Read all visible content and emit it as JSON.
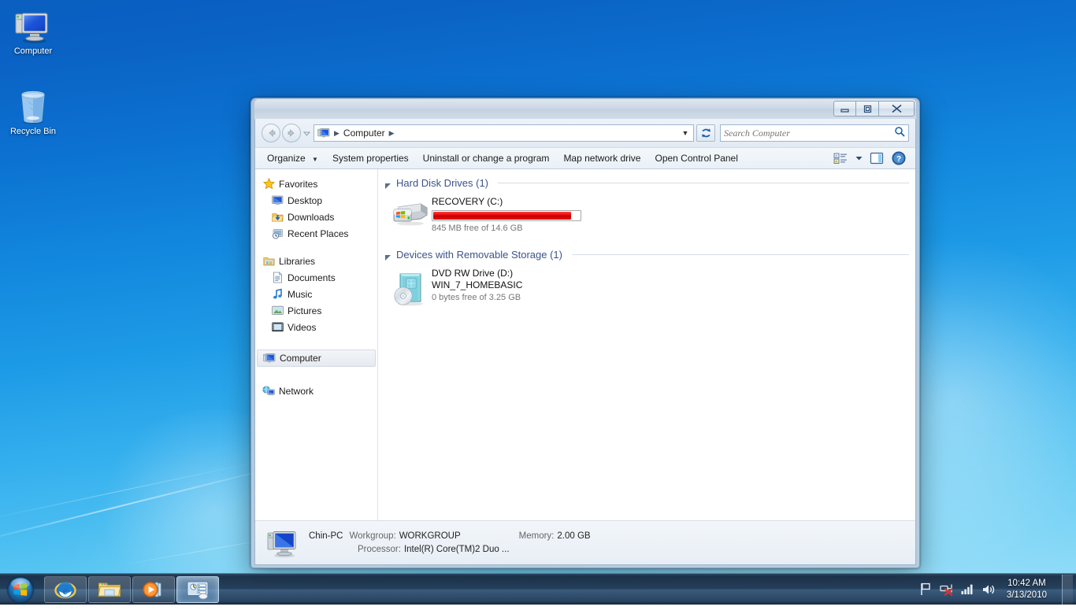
{
  "desktop": {
    "icons": [
      {
        "label": "Computer",
        "icon": "computer-icon"
      },
      {
        "label": "Recycle Bin",
        "icon": "recycle-bin-icon"
      }
    ]
  },
  "window": {
    "title": "",
    "controls": {
      "minimize": "Minimize",
      "maximize": "Maximize",
      "close": "Close"
    },
    "address": {
      "back": "Back",
      "forward": "Forward",
      "history_label": "Recent pages",
      "breadcrumb": [
        "Computer"
      ],
      "refresh": "Refresh"
    },
    "search": {
      "value": "",
      "placeholder": "Search Computer"
    },
    "toolbar": {
      "organize": "Organize",
      "items": [
        "System properties",
        "Uninstall or change a program",
        "Map network drive",
        "Open Control Panel"
      ],
      "views_label": "Change your view",
      "preview_label": "Show the preview pane",
      "help_label": "Get help"
    },
    "navpane": {
      "groups": [
        {
          "header": {
            "label": "Favorites",
            "icon": "star-icon"
          },
          "items": [
            {
              "label": "Desktop",
              "icon": "desktop-icon"
            },
            {
              "label": "Downloads",
              "icon": "downloads-icon"
            },
            {
              "label": "Recent Places",
              "icon": "recent-places-icon"
            }
          ]
        },
        {
          "header": {
            "label": "Libraries",
            "icon": "libraries-icon"
          },
          "items": [
            {
              "label": "Documents",
              "icon": "documents-icon"
            },
            {
              "label": "Music",
              "icon": "music-icon"
            },
            {
              "label": "Pictures",
              "icon": "pictures-icon"
            },
            {
              "label": "Videos",
              "icon": "videos-icon"
            }
          ]
        }
      ],
      "computer": {
        "label": "Computer",
        "icon": "computer-icon",
        "selected": true
      },
      "network": {
        "label": "Network",
        "icon": "network-icon"
      }
    },
    "content": {
      "groups": [
        {
          "title": "Hard Disk Drives (1)",
          "drives": [
            {
              "name": "RECOVERY (C:)",
              "subtitle": "",
              "free_text": "845 MB free of 14.6 GB",
              "has_bar": true,
              "used_percent": 94,
              "bar_color": "#e00000",
              "icon": "hard-disk-icon"
            }
          ]
        },
        {
          "title": "Devices with Removable Storage (1)",
          "drives": [
            {
              "name": "DVD RW Drive (D:)",
              "subtitle": "WIN_7_HOMEBASIC",
              "free_text": "0 bytes free of 3.25 GB",
              "has_bar": false,
              "used_percent": 100,
              "bar_color": "#e00000",
              "icon": "dvd-drive-icon"
            }
          ]
        }
      ]
    },
    "statusbar": {
      "computer_name": "Chin-PC",
      "workgroup_key": "Workgroup:",
      "workgroup_value": "WORKGROUP",
      "memory_key": "Memory:",
      "memory_value": "2.00 GB",
      "processor_key": "Processor:",
      "processor_value": "Intel(R) Core(TM)2 Duo ...",
      "icon": "computer-icon"
    }
  },
  "taskbar": {
    "start_label": "Start",
    "buttons": [
      {
        "name": "internet-explorer",
        "label": "Internet Explorer",
        "active": false
      },
      {
        "name": "windows-explorer",
        "label": "Windows Explorer",
        "active": false
      },
      {
        "name": "windows-media-player",
        "label": "Windows Media Player",
        "active": false
      },
      {
        "name": "computer-window",
        "label": "Computer",
        "active": true
      }
    ],
    "tray": [
      {
        "name": "action-center-icon",
        "label": "Action Center"
      },
      {
        "name": "network-disconnected-icon",
        "label": "Network - not connected"
      },
      {
        "name": "signal-icon",
        "label": "Signal strength"
      },
      {
        "name": "volume-icon",
        "label": "Volume"
      }
    ],
    "clock": {
      "time": "10:42 AM",
      "date": "3/13/2010"
    },
    "show_desktop_label": "Show desktop"
  },
  "colors": {
    "accent": "#3b5488",
    "drive_bar_red": "#e00000",
    "taskbar": "#1e3450",
    "wallpaper_top": "#0a5fc0",
    "wallpaper_bottom": "#9adff8"
  }
}
